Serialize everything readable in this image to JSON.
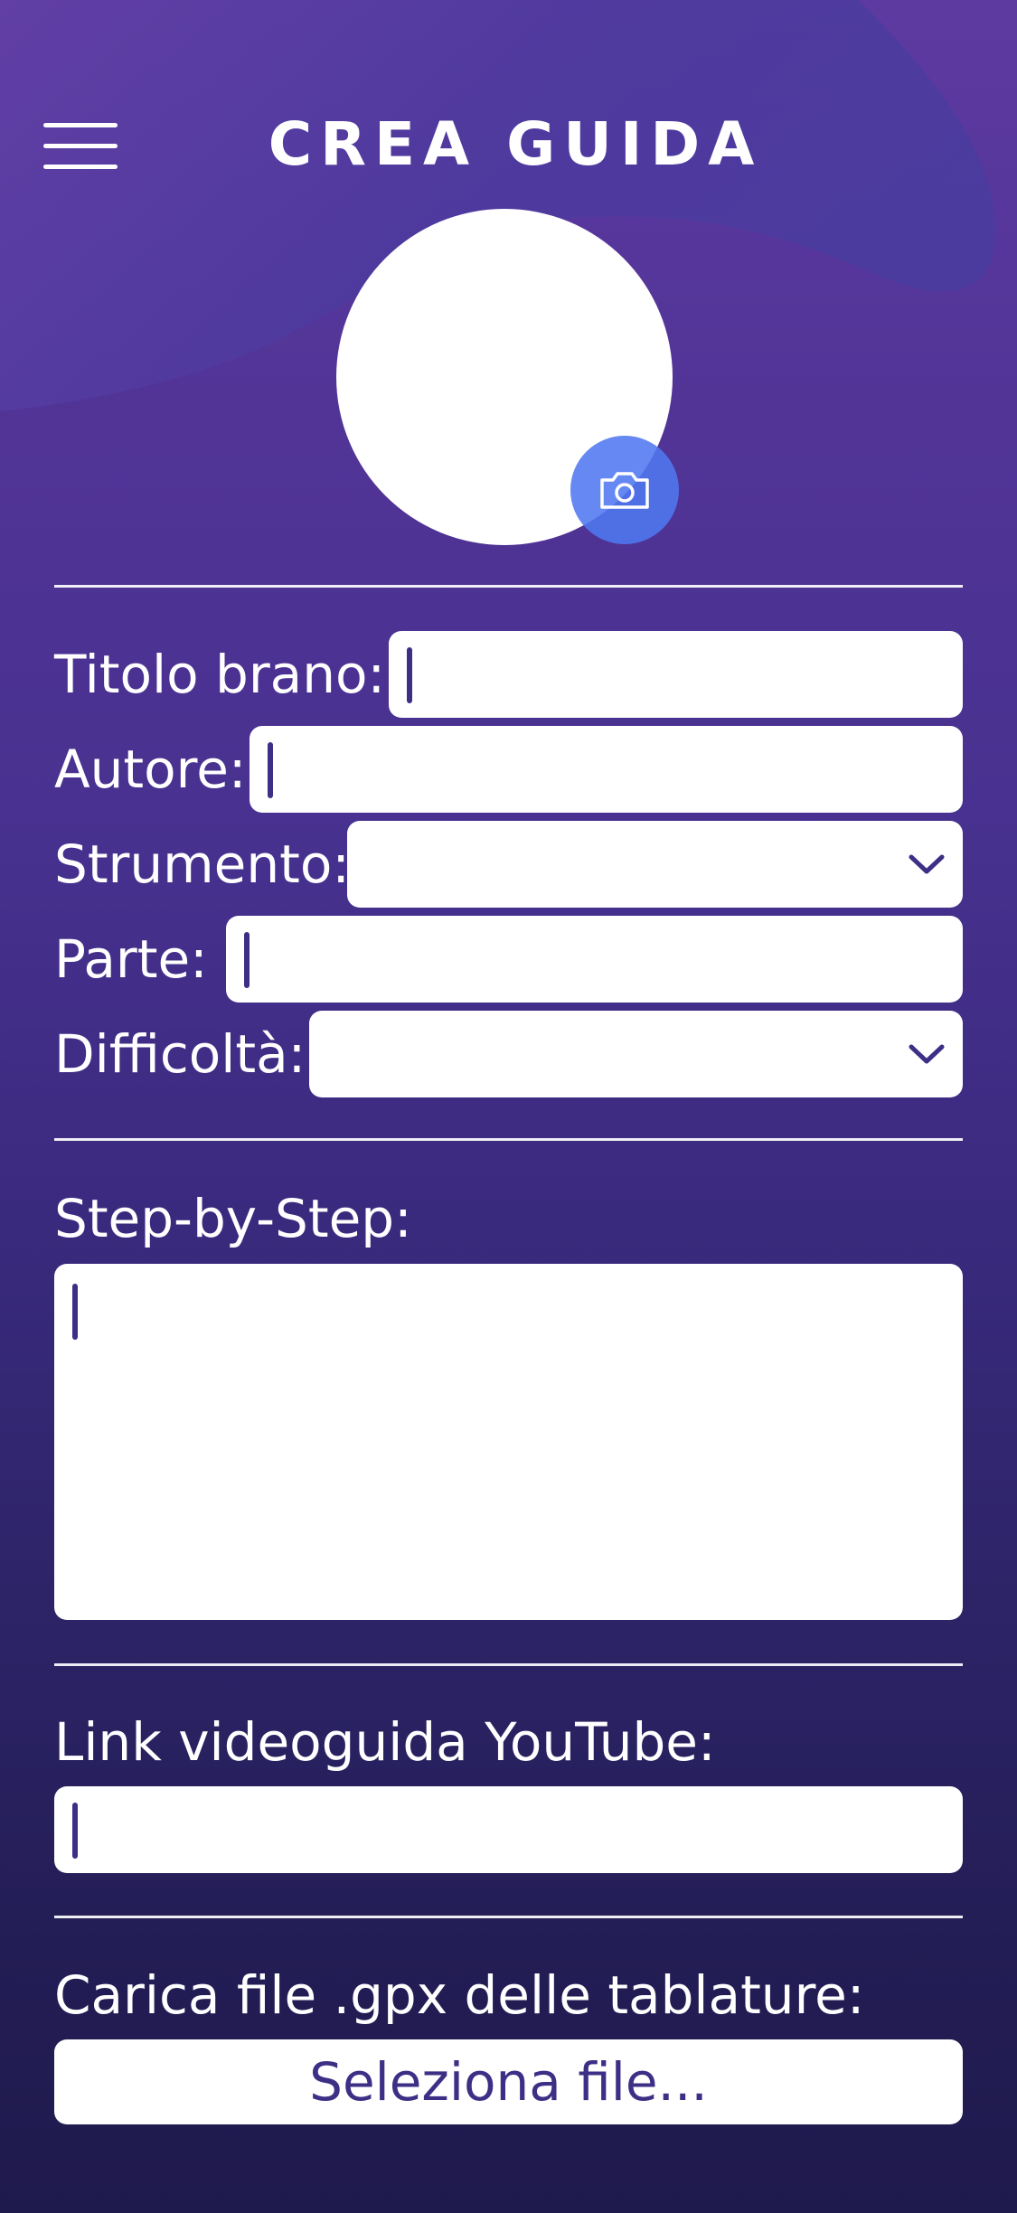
{
  "header": {
    "title": "CREA GUIDA",
    "menu_icon": "hamburger-menu-icon"
  },
  "avatar": {
    "upload_icon": "camera-icon"
  },
  "form": {
    "fields": [
      {
        "label": "Titolo brano:",
        "type": "text",
        "value": ""
      },
      {
        "label": "Autore:",
        "type": "text",
        "value": ""
      },
      {
        "label": "Strumento:",
        "type": "select",
        "value": ""
      },
      {
        "label": "Parte:",
        "type": "text",
        "value": ""
      },
      {
        "label": "Difficoltà:",
        "type": "select",
        "value": ""
      }
    ],
    "step_by_step": {
      "label": "Step-by-Step:",
      "value": ""
    },
    "youtube": {
      "label": "Link videoguida YouTube:",
      "value": ""
    },
    "tabs_file": {
      "label": "Carica file .gpx delle tablature:",
      "button_label": "Seleziona file..."
    }
  },
  "colors": {
    "background_top": "#5d3aa0",
    "background_bottom": "#1f1a4d",
    "camera_button": "#5078f0",
    "text_caret": "#3e2f86",
    "field_background": "#ffffff"
  }
}
